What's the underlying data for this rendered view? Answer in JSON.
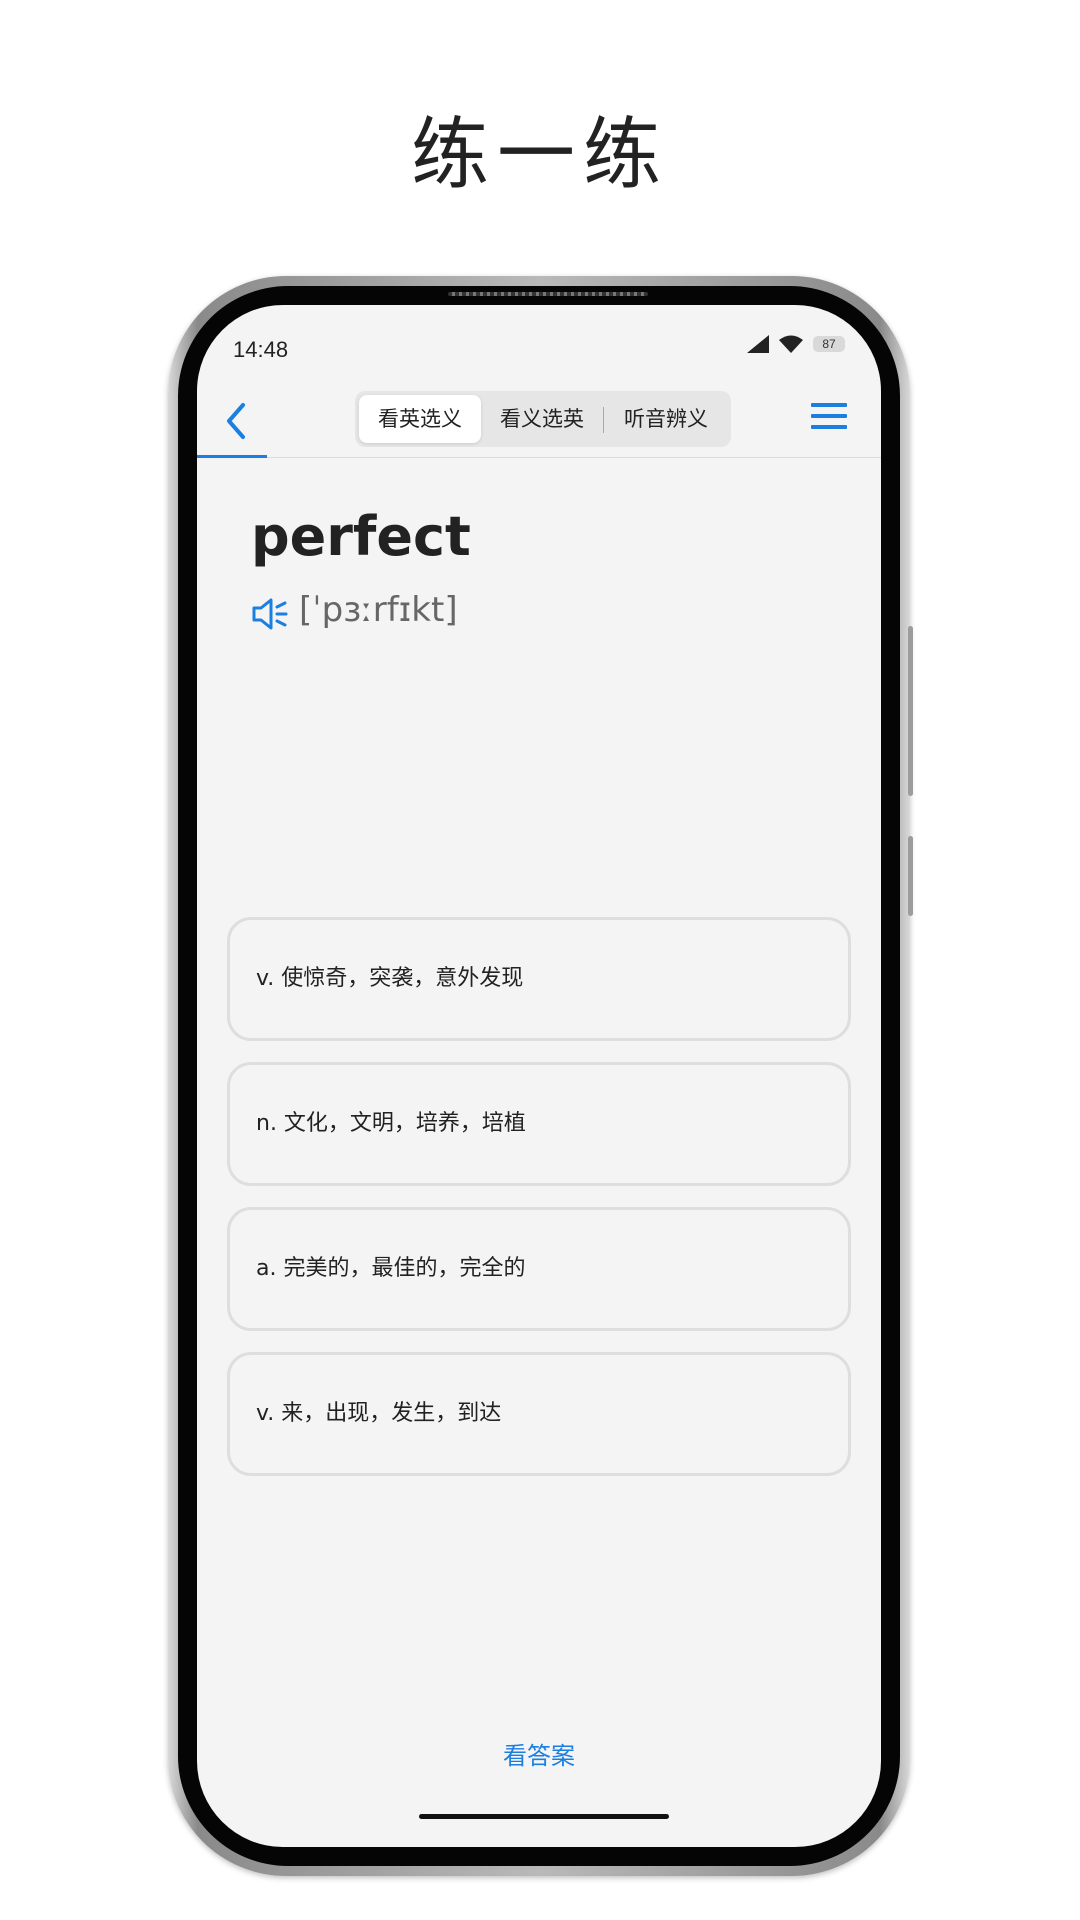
{
  "promo": {
    "title": "练一练"
  },
  "status_bar": {
    "time": "14:48",
    "battery": "87",
    "icons": [
      "signal-icon",
      "wifi-icon",
      "battery-icon"
    ]
  },
  "nav": {
    "back_icon": "chevron-left-icon",
    "menu_icon": "menu-icon",
    "tabs": [
      {
        "label": "看英选义",
        "active": true
      },
      {
        "label": "看义选英",
        "active": false
      },
      {
        "label": "听音辨义",
        "active": false
      }
    ]
  },
  "word": {
    "text": "perfect",
    "phonetic": "[ˈpɜːrfɪkt]",
    "speaker_icon": "speaker-icon"
  },
  "options": [
    {
      "text": "v. 使惊奇，突袭，意外发现"
    },
    {
      "text": "n. 文化，文明，培养，培植"
    },
    {
      "text": "a. 完美的，最佳的，完全的"
    },
    {
      "text": "v. 来，出现，发生，到达"
    }
  ],
  "footer": {
    "view_answer": "看答案"
  },
  "colors": {
    "accent": "#1a7fe0",
    "background": "#f4f4f4",
    "border": "#dedede"
  }
}
